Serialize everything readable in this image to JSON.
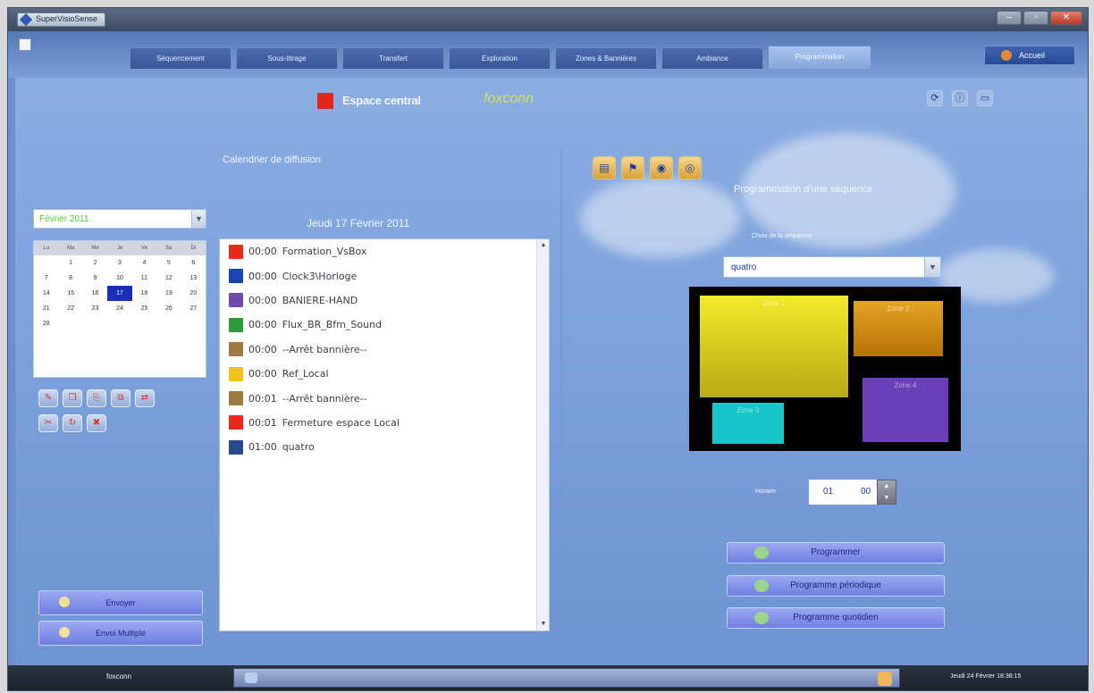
{
  "window": {
    "title": "SuperVisioSense",
    "minimize": "–",
    "maximize": "▫",
    "close": "✕"
  },
  "tabs": [
    "Séquencement",
    "Sous-titrage",
    "Transfert",
    "Exploration",
    "Zones & Bannières",
    "Ambiance",
    "Programmation"
  ],
  "active_tab": "Programmation",
  "accueil_label": "Accueil",
  "header": {
    "space_label": "Espace central",
    "brand": "foxconn"
  },
  "calendar": {
    "title": "Calendrier de diffusion",
    "month": "Février 2011",
    "weekdays": [
      "Lu",
      "Ma",
      "Me",
      "Je",
      "Ve",
      "Sa",
      "Di"
    ],
    "rows": [
      [
        "",
        "1",
        "2",
        "3",
        "4",
        "5",
        "6"
      ],
      [
        "7",
        "8",
        "9",
        "10",
        "11",
        "12",
        "13"
      ],
      [
        "14",
        "15",
        "16",
        "17",
        "18",
        "19",
        "20"
      ],
      [
        "21",
        "22",
        "23",
        "24",
        "25",
        "26",
        "27"
      ],
      [
        "28",
        "",
        "",
        "",
        "",
        "",
        ""
      ]
    ],
    "selected_day": "17"
  },
  "left_buttons": {
    "envoyer": "Envoyer",
    "envoi_multiple": "Envoi Multiple"
  },
  "schedule": {
    "date": "Jeudi 17 Février 2011",
    "items": [
      {
        "time": "00:00",
        "label": "Formation_VsBox",
        "color": "#e8281d"
      },
      {
        "time": "00:00",
        "label": "Clock3\\Horloge",
        "color": "#1d44b4"
      },
      {
        "time": "00:00",
        "label": "BANIERE-HAND",
        "color": "#6b4aa8"
      },
      {
        "time": "00:00",
        "label": "Flux_BR_Bfm_Sound",
        "color": "#2d9c3c"
      },
      {
        "time": "00:00",
        "label": "--Arrêt bannière--",
        "color": "#9c7a42"
      },
      {
        "time": "00:00",
        "label": "Ref_Local",
        "color": "#f0c21b"
      },
      {
        "time": "00:01",
        "label": "--Arrêt bannière--",
        "color": "#9c7a42"
      },
      {
        "time": "00:01",
        "label": "Fermeture espace Local",
        "color": "#e8281d"
      },
      {
        "time": "01:00",
        "label": "quatro",
        "color": "#284a8c"
      }
    ]
  },
  "programming": {
    "title": "Programmation d'une séquence",
    "choice_label": "Choix de la séquence",
    "sequence": "quatro",
    "zones": [
      "Zone 1",
      "Zone 2",
      "Zone 3",
      "Zone 4"
    ],
    "hour_label": "Horaire",
    "hour": "01",
    "minute": "00",
    "buttons": [
      "Programmer",
      "Programme périodique",
      "Programme quotidien"
    ]
  },
  "taskbar": {
    "user": "foxconn",
    "datetime": "Jeudi 24 Février 18:38:15"
  }
}
